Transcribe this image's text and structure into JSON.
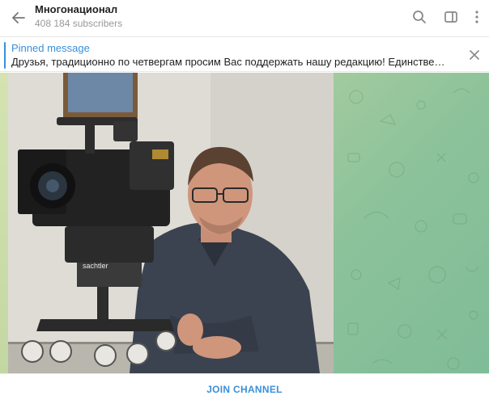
{
  "header": {
    "title": "Многонационал",
    "subtitle": "408 184 subscribers",
    "icons": [
      "back-arrow-icon",
      "search-icon",
      "sidebar-toggle-icon",
      "more-vertical-icon"
    ]
  },
  "pinned": {
    "label": "Pinned message",
    "text": "Друзья, традиционно по четвергам просим Вас поддержать нашу редакцию!  Единственн..."
  },
  "camera_label": "sachtler",
  "footer": {
    "join_label": "JOIN CHANNEL"
  },
  "colors": {
    "accent": "#3a8fd8",
    "chat_bg": "#a9cda0"
  }
}
